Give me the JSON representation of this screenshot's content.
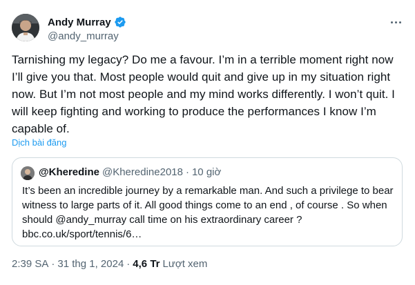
{
  "tweet": {
    "author": {
      "name": "Andy Murray",
      "handle": "@andy_murray",
      "verified": true
    },
    "text": "Tarnishing my legacy? Do me a favour. I’m in a terrible moment right now I’ll give you that. Most people would quit and give up in my situation right now. But I’m not most people and my mind works differently. I won’t quit. I will keep fighting and working to produce the performances I know I’m capable of.",
    "translate_label": "Dịch bài đăng",
    "quote": {
      "name": "@Kheredine",
      "handle": "@Kheredine2018",
      "separator": "·",
      "time": "10 giờ",
      "text": "It’s been an incredible journey by a remarkable man. And such a privilege to bear witness to large parts of it.  All good things come to an end , of course . So when should @andy_murray call time on his extraordinary career ? bbc.co.uk/sport/tennis/6…"
    },
    "meta": {
      "time": "2:39 SA",
      "separator": "·",
      "date": "31 thg 1, 2024",
      "views_count": "4,6 Tr",
      "views_label": "Lượt xem"
    }
  },
  "icons": {
    "verified": "verified-badge-icon",
    "more": "more-options-icon"
  },
  "colors": {
    "accent": "#1d9bf0",
    "text_primary": "#0f1419",
    "text_secondary": "#536471",
    "border": "#cfd9de"
  }
}
